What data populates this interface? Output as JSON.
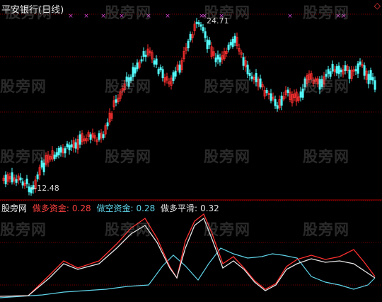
{
  "header": {
    "title": "平安银行(日线)",
    "corner_icon": "diamond-icon",
    "corner_color": "#ff3b3b"
  },
  "annotations": {
    "high_label": "24.71",
    "low_label": "12.48"
  },
  "watermark": "股旁网",
  "indicator": {
    "source_label": "股旁网",
    "series": [
      {
        "name": "做多资金:",
        "value": "0.28",
        "color": "#ff4040"
      },
      {
        "name": "做空资金:",
        "value": "0.28",
        "color": "#5fd3e8"
      },
      {
        "name": "做多平滑:",
        "value": "0.32",
        "color": "#e6e6e6"
      }
    ]
  },
  "colors": {
    "up_candle": "#ff3030",
    "down_candle": "#54ffff",
    "grid": "#7a0000",
    "signal": "#cc44cc"
  }
}
